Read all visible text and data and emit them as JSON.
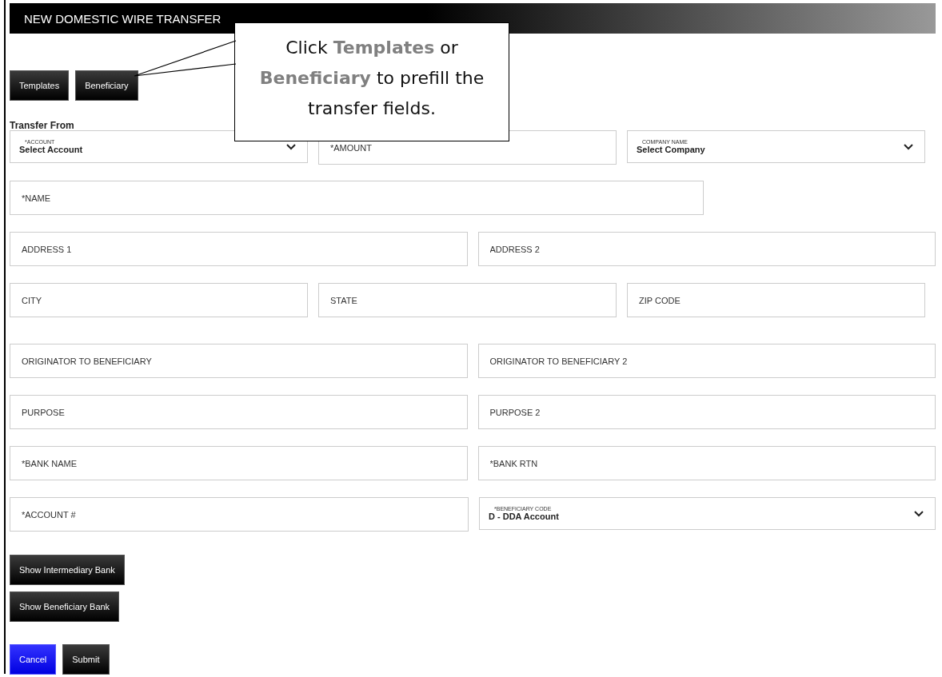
{
  "header": {
    "title": "NEW DOMESTIC WIRE TRANSFER"
  },
  "top_buttons": [
    "Templates",
    "Beneficiary"
  ],
  "callout": {
    "text": "Click **Templates** or **Beneficiary** to prefill the transfer fields."
  },
  "section_label": "Transfer From",
  "rows": [
    {
      "fields": [
        {
          "kind": "select",
          "label": "*ACCOUNT",
          "value": "Select Account"
        },
        {
          "kind": "text",
          "placeholder": "*AMOUNT"
        },
        {
          "kind": "select",
          "label": "COMPANY NAME",
          "value": "Select Company"
        }
      ]
    },
    {
      "fields": [
        {
          "kind": "text",
          "placeholder": "*NAME"
        }
      ]
    },
    {
      "fields": [
        {
          "kind": "text",
          "placeholder": "ADDRESS 1"
        },
        {
          "kind": "text",
          "placeholder": "ADDRESS 2"
        }
      ]
    },
    {
      "fields": [
        {
          "kind": "text",
          "placeholder": "CITY"
        },
        {
          "kind": "text",
          "placeholder": "STATE"
        },
        {
          "kind": "text",
          "placeholder": "ZIP CODE"
        }
      ]
    },
    {
      "fields": [
        {
          "kind": "text",
          "placeholder": "ORIGINATOR TO BENEFICIARY"
        },
        {
          "kind": "text",
          "placeholder": "ORIGINATOR TO BENEFICIARY 2"
        }
      ]
    },
    {
      "fields": [
        {
          "kind": "text",
          "placeholder": "PURPOSE"
        },
        {
          "kind": "text",
          "placeholder": "PURPOSE 2"
        }
      ]
    },
    {
      "fields": [
        {
          "kind": "text",
          "placeholder": "*BANK NAME"
        },
        {
          "kind": "text",
          "placeholder": "*BANK RTN"
        }
      ]
    },
    {
      "fields": [
        {
          "kind": "text",
          "placeholder": "*ACCOUNT #"
        },
        {
          "kind": "select",
          "label": "*BENEFICIARY CODE",
          "value": "D - DDA Account"
        }
      ]
    }
  ],
  "toggle_buttons": [
    "Show Intermediary Bank",
    "Show Beneficiary Bank"
  ],
  "actions": [
    {
      "label": "Cancel",
      "kind": "cancel"
    },
    {
      "label": "Submit",
      "kind": "submit"
    }
  ]
}
